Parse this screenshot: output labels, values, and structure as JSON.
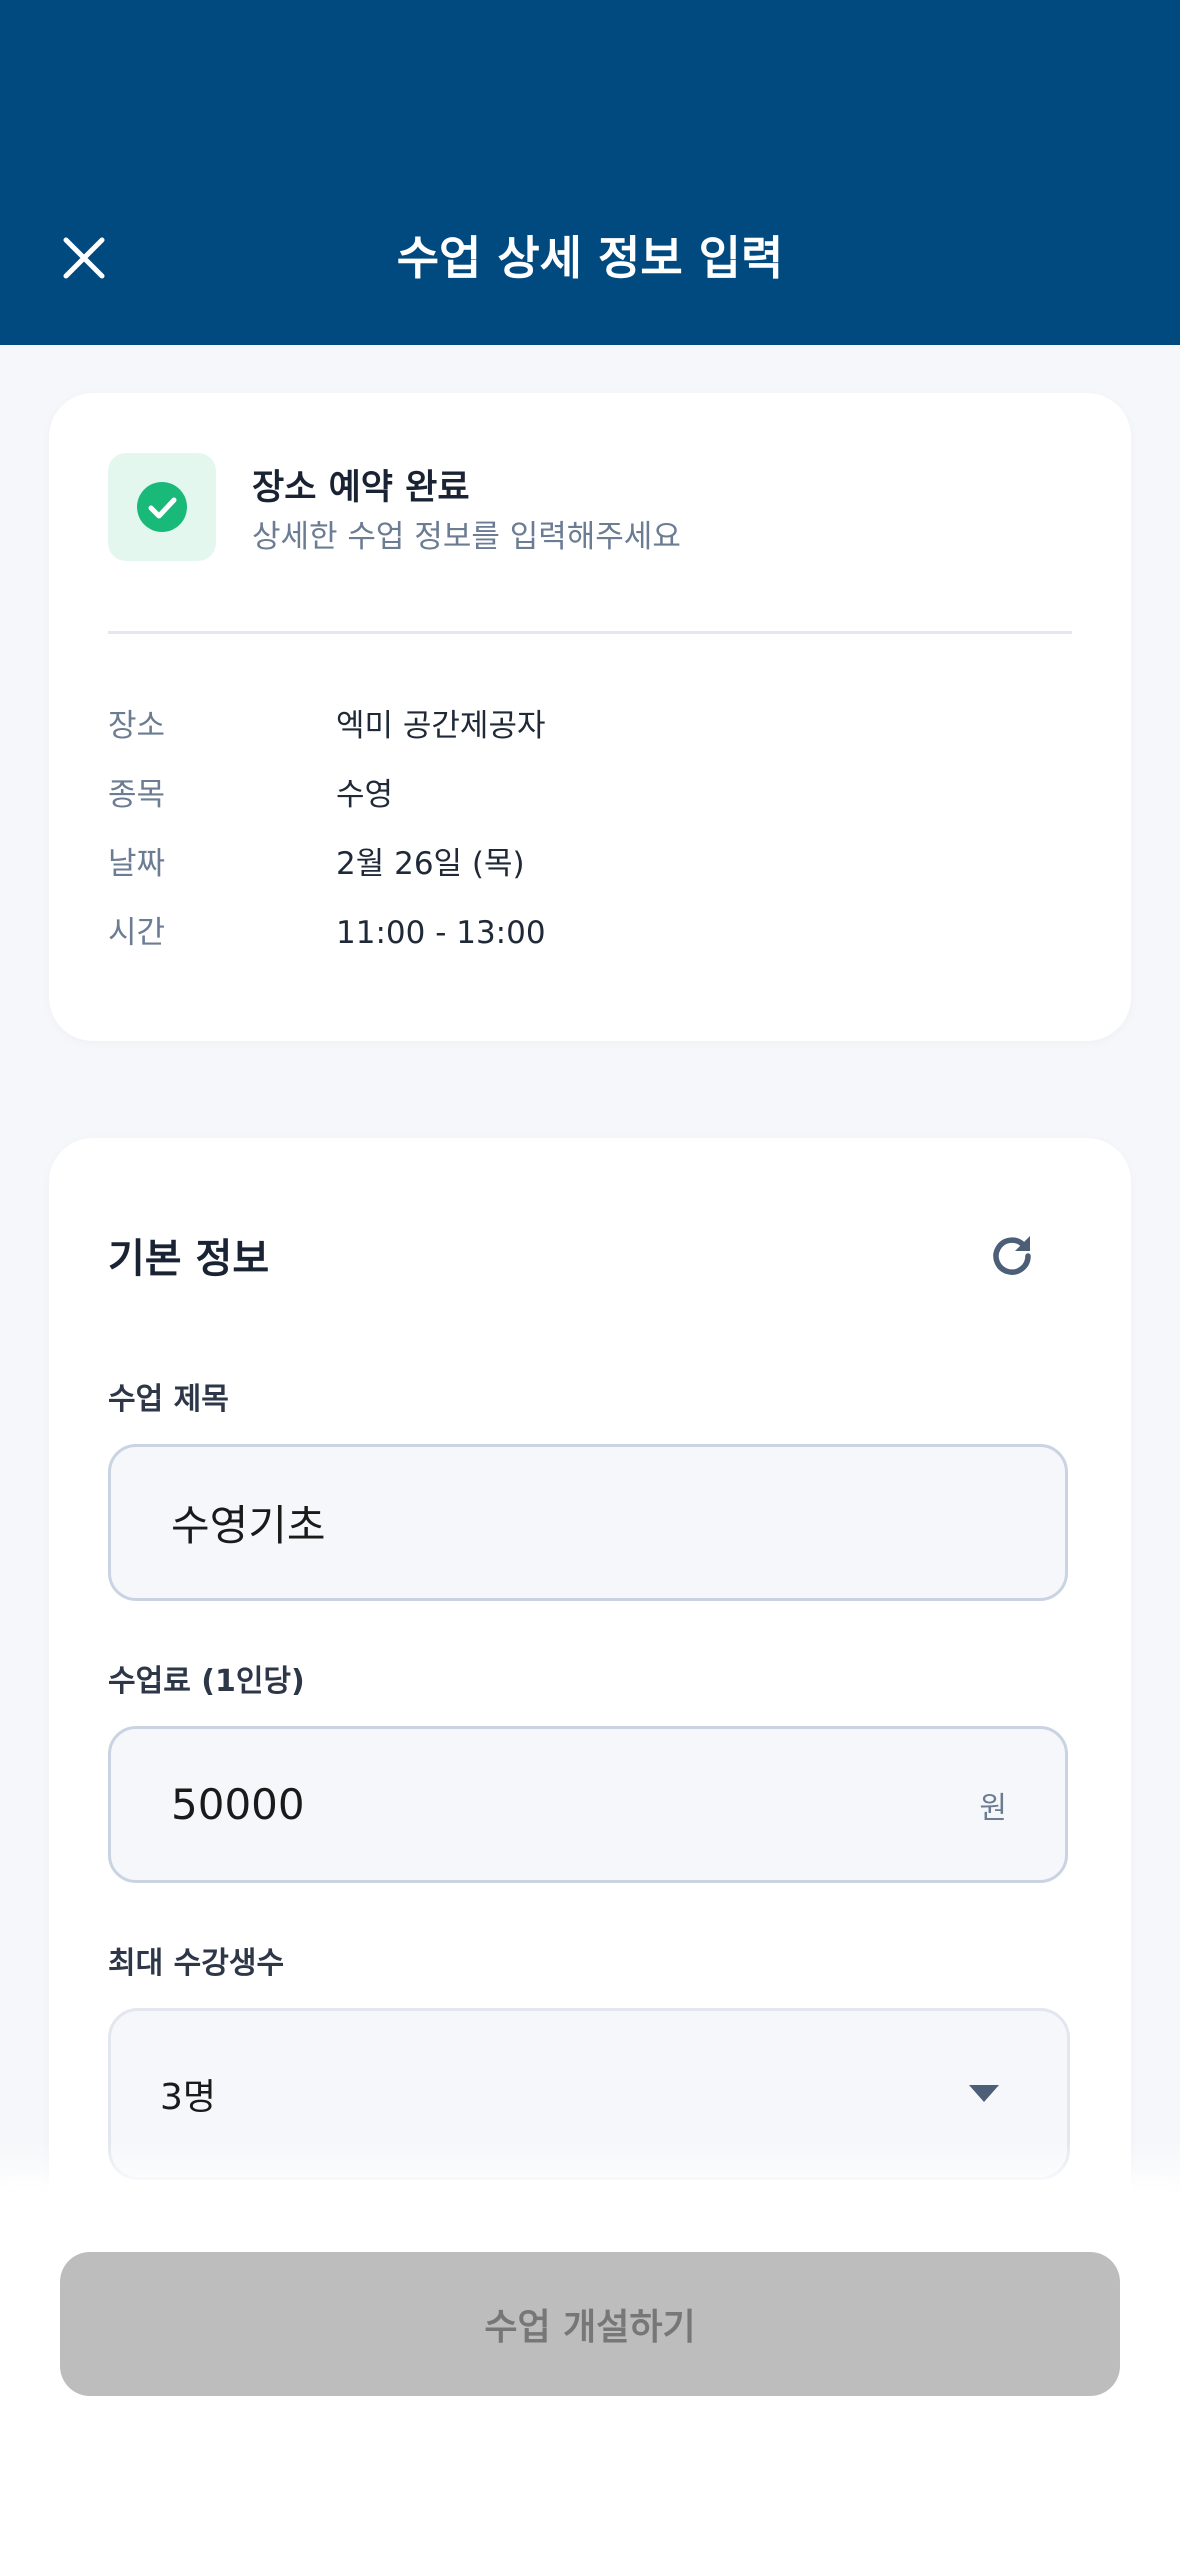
{
  "header": {
    "title": "수업 상세 정보 입력",
    "background": "#004a7f"
  },
  "reservation": {
    "title": "장소 예약 완료",
    "subtitle": "상세한 수업 정보를 입력해주세요",
    "check_color": "#19b97a",
    "rows": [
      {
        "label": "장소",
        "value": "엑미 공간제공자"
      },
      {
        "label": "종목",
        "value": "수영"
      },
      {
        "label": "날짜",
        "value": "2월 26일 (목)"
      },
      {
        "label": "시간",
        "value": "11:00 - 13:00"
      }
    ]
  },
  "basic_info": {
    "title": "기본 정보",
    "class_title": {
      "label": "수업 제목",
      "value": "수영기초"
    },
    "fee": {
      "label": "수업료 (1인당)",
      "value": "50000",
      "unit": "원"
    },
    "max_students": {
      "label": "최대 수강생수",
      "value": "3명"
    }
  },
  "footer": {
    "submit_label": "수업 개설하기"
  }
}
